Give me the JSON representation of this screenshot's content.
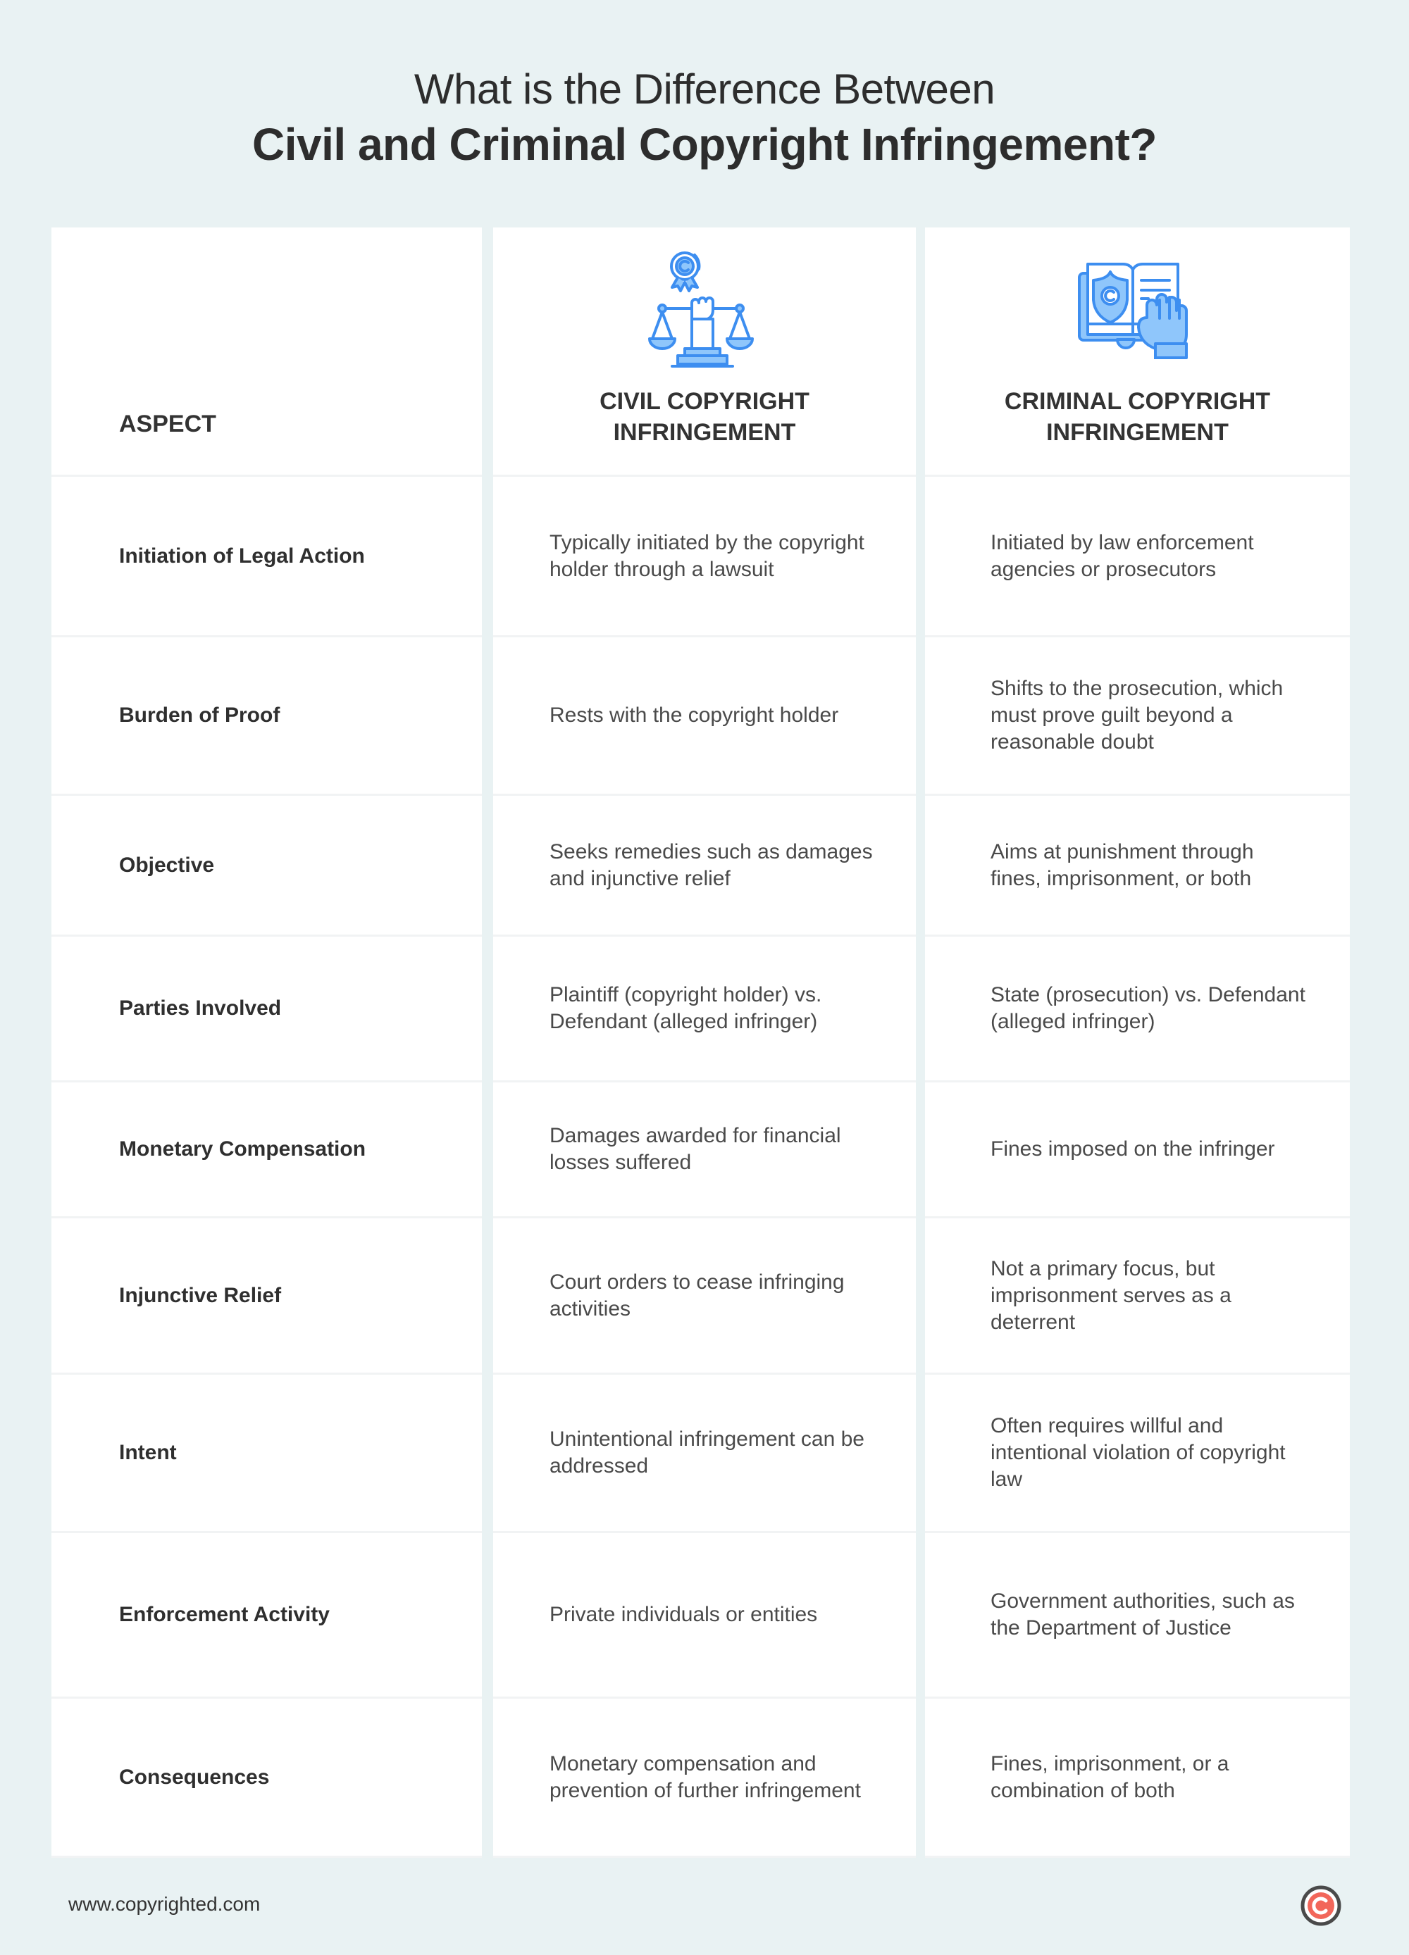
{
  "title": {
    "line1": "What is the Difference Between",
    "line2": "Civil and Criminal Copyright Infringement?"
  },
  "table": {
    "headers": {
      "aspect": "ASPECT",
      "civil": "CIVIL COPYRIGHT INFRINGEMENT",
      "criminal": "CRIMINAL COPYRIGHT INFRINGEMENT",
      "civil_icon": "scales-of-justice-copyright-icon",
      "criminal_icon": "law-book-oath-hand-icon"
    },
    "rows": [
      {
        "aspect": "Initiation of Legal Action",
        "civil": "Typically initiated by the copyright holder through a lawsuit",
        "criminal": "Initiated by law enforcement agencies or prosecutors"
      },
      {
        "aspect": "Burden of Proof",
        "civil": "Rests with the copyright holder",
        "criminal": "Shifts to the prosecution, which must prove guilt beyond a reasonable doubt"
      },
      {
        "aspect": "Objective",
        "civil": "Seeks remedies such as damages and injunctive relief",
        "criminal": "Aims at punishment through fines, imprisonment, or both"
      },
      {
        "aspect": "Parties Involved",
        "civil": "Plaintiff (copyright holder) vs. Defendant (alleged infringer)",
        "criminal": "State (prosecution) vs. Defendant (alleged infringer)"
      },
      {
        "aspect": "Monetary Compensation",
        "civil": "Damages awarded for financial losses suffered",
        "criminal": "Fines imposed on the infringer"
      },
      {
        "aspect": "Injunctive Relief",
        "civil": "Court orders to cease infringing activities",
        "criminal": "Not a primary focus, but imprisonment serves as a deterrent"
      },
      {
        "aspect": "Intent",
        "civil": "Unintentional infringement can be addressed",
        "criminal": "Often requires willful and intentional violation of copyright law"
      },
      {
        "aspect": "Enforcement Activity",
        "civil": "Private individuals or entities",
        "criminal": "Government authorities, such as the Department of Justice"
      },
      {
        "aspect": "Consequences",
        "civil": "Monetary compensation and prevention of further infringement",
        "criminal": "Fines, imprisonment, or a combination of both"
      }
    ]
  },
  "footer": {
    "url": "www.copyrighted.com",
    "logo_icon": "copyright-logo-icon"
  },
  "colors": {
    "background": "#e9f2f3",
    "icon_blue": "#3d8ef0",
    "icon_fill": "#8fc6fb",
    "logo_red": "#f2665a",
    "logo_ring": "#4a4a4a"
  }
}
